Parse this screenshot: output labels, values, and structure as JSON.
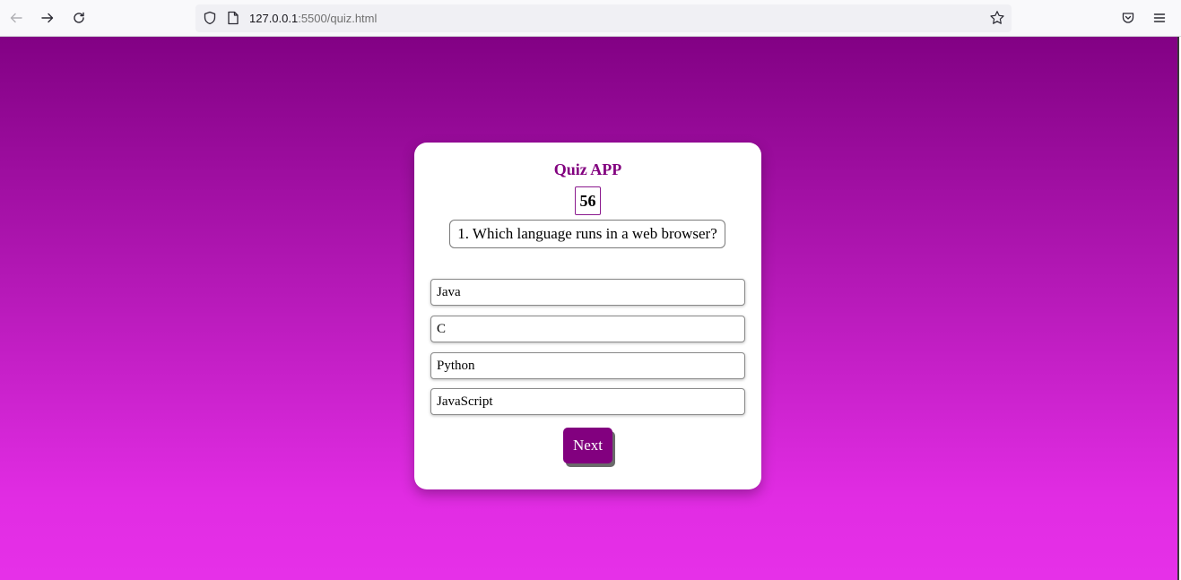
{
  "browser": {
    "url_host": "127.0.0.1",
    "url_path": ":5500/quiz.html",
    "icons": {
      "back": "back-arrow-icon",
      "forward": "forward-arrow-icon",
      "reload": "reload-icon",
      "tracking": "shield-icon",
      "page": "page-icon",
      "bookmark": "star-icon",
      "pocket": "pocket-icon",
      "menu": "hamburger-menu-icon"
    }
  },
  "quiz": {
    "title": "Quiz APP",
    "timer": "56",
    "question": "1. Which language runs in a web browser?",
    "options": [
      "Java",
      "C",
      "Python",
      "JavaScript"
    ],
    "next_label": "Next"
  },
  "colors": {
    "accent": "#82007f",
    "gradient_top": "#820184",
    "gradient_bottom": "#e630e8",
    "card_bg": "#ffffff"
  }
}
